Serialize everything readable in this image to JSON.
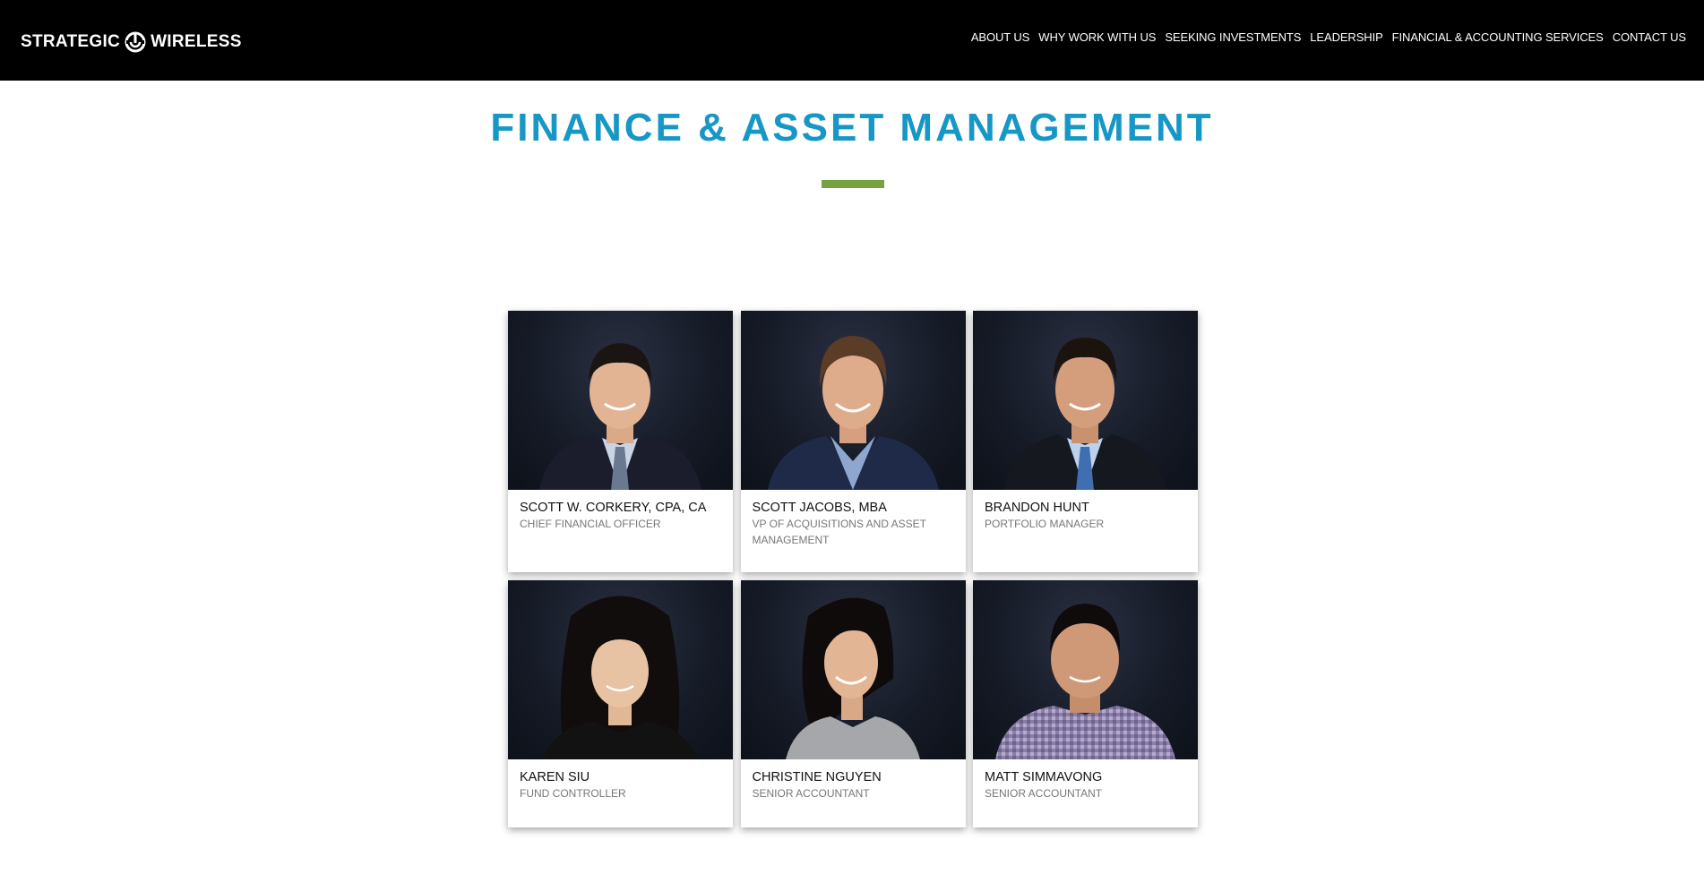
{
  "header": {
    "logo_left": "STRATEGIC",
    "logo_right": "WIRELESS",
    "logo_icon": "strategic-wireless-mark-icon",
    "nav": [
      {
        "label": "ABOUT US"
      },
      {
        "label": "WHY WORK WITH US"
      },
      {
        "label": "SEEKING INVESTMENTS"
      },
      {
        "label": "LEADERSHIP"
      },
      {
        "label": "FINANCIAL & ACCOUNTING SERVICES"
      },
      {
        "label": "CONTACT US"
      }
    ]
  },
  "main": {
    "title": "FINANCE & ASSET MANAGEMENT",
    "team": [
      {
        "name": "SCOTT W. CORKERY, CPA, CA",
        "role": "CHIEF FINANCIAL OFFICER",
        "photo": "headshot-man-dark-suit-striped-tie"
      },
      {
        "name": "SCOTT JACOBS, MBA",
        "role": "VP OF ACQUISITIONS AND ASSET MANAGEMENT",
        "photo": "headshot-man-navy-blazer-open-collar"
      },
      {
        "name": "BRANDON HUNT",
        "role": "PORTFOLIO MANAGER",
        "photo": "headshot-man-dark-suit-blue-tie"
      },
      {
        "name": "KAREN SIU",
        "role": "FUND CONTROLLER",
        "photo": "headshot-woman-black-top"
      },
      {
        "name": "CHRISTINE NGUYEN",
        "role": "SENIOR ACCOUNTANT",
        "photo": "headshot-woman-grey-top"
      },
      {
        "name": "MATT SIMMAVONG",
        "role": "SENIOR ACCOUNTANT",
        "photo": "headshot-man-checkered-shirt"
      }
    ]
  },
  "colors": {
    "header_bg": "#000000",
    "title": "#1797c6",
    "accent_rule": "#76a33f",
    "role_text": "#777777"
  }
}
